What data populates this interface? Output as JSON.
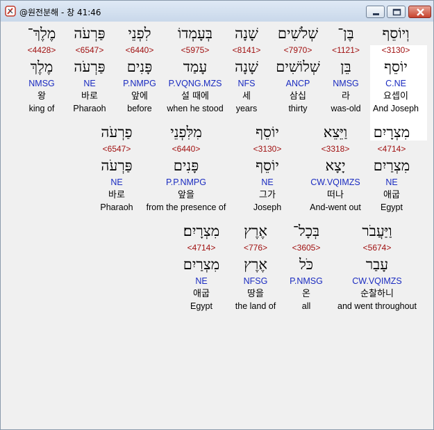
{
  "window": {
    "title": "@원전분해 - 창 41:46",
    "buttons": {
      "minimize": "minimize",
      "maximize": "maximize",
      "close": "close"
    }
  },
  "lines": [
    {
      "words": [
        {
          "hebrew": "וְיוֹסֵף",
          "strong": "<3130>",
          "lemma": "יוֹסֵף",
          "parsing": "C.NE",
          "korean": "요셉이",
          "english": "And Joseph",
          "highlighted": true
        },
        {
          "hebrew": "בֶּן־",
          "strong": "<1121>",
          "lemma": "בֵּן",
          "parsing": "NMSG",
          "korean": "라",
          "english": "was-old"
        },
        {
          "hebrew": "שְׁלֹשִׁים",
          "strong": "<7970>",
          "lemma": "שְׁלוֹשִׁים",
          "parsing": "ANCP",
          "korean": "삼십",
          "english": "thirty"
        },
        {
          "hebrew": "שָׁנָה",
          "strong": "<8141>",
          "lemma": "שָׁנָה",
          "parsing": "NFS",
          "korean": "세",
          "english": "years"
        },
        {
          "hebrew": "בְּעָמְדוֹ",
          "strong": "<5975>",
          "lemma": "עָמַד",
          "parsing": "P.VQNG.MZS",
          "korean": "설 때에",
          "english": "when he stood"
        },
        {
          "hebrew": "לִפְנֵי",
          "strong": "<6440>",
          "lemma": "פָּנִים",
          "parsing": "P.NMPG",
          "korean": "앞에",
          "english": "before"
        },
        {
          "hebrew": "פַּרְעֹה",
          "strong": "<6547>",
          "lemma": "פַּרְעֹה",
          "parsing": "NE",
          "korean": "바로",
          "english": "Pharaoh"
        },
        {
          "hebrew": "מֶלֶךְ־",
          "strong": "<4428>",
          "lemma": "מֶלֶךְ",
          "parsing": "NMSG",
          "korean": "왕",
          "english": "king of"
        }
      ]
    },
    {
      "words": [
        {
          "hebrew": "מִצְרָיִם",
          "strong": "<4714>",
          "lemma": "מִצְרַיִם",
          "parsing": "NE",
          "korean": "애굽",
          "english": "Egypt"
        },
        {
          "hebrew": "וַיֵּצֵא",
          "strong": "<3318>",
          "lemma": "יָצָא",
          "parsing": "CW.VQIMZS",
          "korean": "떠나",
          "english": "And-went out"
        },
        {
          "hebrew": "יוֹסֵף",
          "strong": "<3130>",
          "lemma": "יוֹסֵף",
          "parsing": "NE",
          "korean": "그가",
          "english": "Joseph"
        },
        {
          "hebrew": "מִלִּפְנֵי",
          "strong": "<6440>",
          "lemma": "פָּנִים",
          "parsing": "P.P.NMPG",
          "korean": "앞을",
          "english": "from the presence of"
        },
        {
          "hebrew": "פַרְעֹה",
          "strong": "<6547>",
          "lemma": "פַּרְעֹה",
          "parsing": "NE",
          "korean": "바로",
          "english": "Pharaoh"
        }
      ]
    },
    {
      "words": [
        {
          "hebrew": "וַיַּעֲבֹר",
          "strong": "<5674>",
          "lemma": "עָבַר",
          "parsing": "CW.VQIMZS",
          "korean": "순찰하니",
          "english": "and went throughout"
        },
        {
          "hebrew": "בְּכָל־",
          "strong": "<3605>",
          "lemma": "כֹּל",
          "parsing": "P.NMSG",
          "korean": "온",
          "english": "all"
        },
        {
          "hebrew": "אֶרֶץ",
          "strong": "<776>",
          "lemma": "אֶרֶץ",
          "parsing": "NFSG",
          "korean": "땅을",
          "english": "the land of"
        },
        {
          "hebrew": "מִצְרָיִם׃",
          "strong": "<4714>",
          "lemma": "מִצְרַיִם",
          "parsing": "NE",
          "korean": "애굽",
          "english": "Egypt"
        }
      ]
    }
  ]
}
